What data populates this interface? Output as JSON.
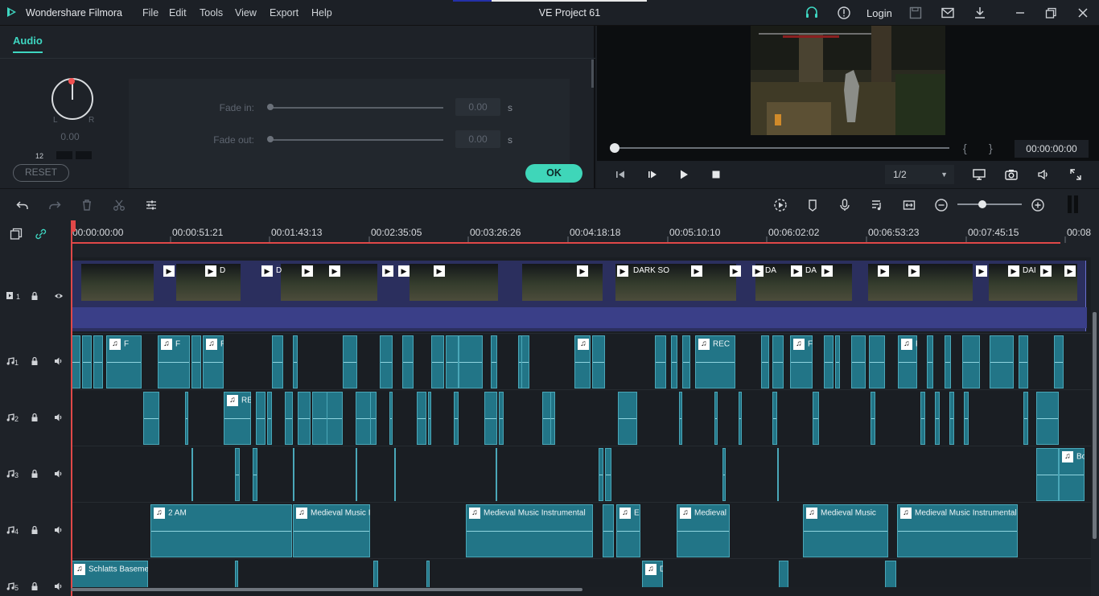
{
  "titlebar": {
    "app_name": "Wondershare Filmora",
    "menu": [
      "File",
      "Edit",
      "Tools",
      "View",
      "Export",
      "Help"
    ],
    "project_title": "VE Project 61",
    "login": "Login"
  },
  "audio_panel": {
    "tab": "Audio",
    "knob_left": "L",
    "knob_right": "R",
    "knob_value": "0.00",
    "meter_label": "12",
    "fade_in_label": "Fade in:",
    "fade_out_label": "Fade out:",
    "fade_in_value": "0.00",
    "fade_out_value": "0.00",
    "unit": "s",
    "reset": "RESET",
    "ok": "OK"
  },
  "preview": {
    "time": "00:00:00:00",
    "ratio": "1/2",
    "brace_left": "{",
    "brace_right": "}",
    "progress": 0.0
  },
  "timeline": {
    "ruler": [
      "00:00:00:00",
      "00:00:51:21",
      "00:01:43:13",
      "00:02:35:05",
      "00:03:26:26",
      "00:04:18:18",
      "00:05:10:10",
      "00:06:02:02",
      "00:06:53:23",
      "00:07:45:15",
      "00:08"
    ],
    "tracks": [
      {
        "label": "1",
        "kind": "video"
      },
      {
        "label": "1",
        "kind": "audio"
      },
      {
        "label": "2",
        "kind": "audio"
      },
      {
        "label": "3",
        "kind": "audio"
      },
      {
        "label": "4",
        "kind": "audio"
      },
      {
        "label": "5",
        "kind": "audio"
      }
    ],
    "video_captions": [
      "D",
      "D",
      "DARK SO",
      "DA",
      "DA",
      "DAI"
    ],
    "audio1_captions": [
      "F",
      "F",
      "REC",
      "F",
      "F"
    ],
    "audio2_captions": [
      "RE"
    ],
    "audio3_captions": [
      "E",
      "Bo"
    ],
    "audio4_captions": [
      "2 AM",
      "Medieval Music I",
      "Medieval Music Instrumental",
      "E",
      "Medieval",
      "Medieval Music",
      "Medieval Music Instrumental"
    ],
    "audio5_captions": [
      "Schlatts Basemen",
      "D"
    ],
    "zoom": 0.35
  },
  "colors": {
    "accent": "#3ed6c1",
    "playhead": "#e04848",
    "audio_clip": "#227587",
    "video_clip": "#2b2f5e"
  }
}
